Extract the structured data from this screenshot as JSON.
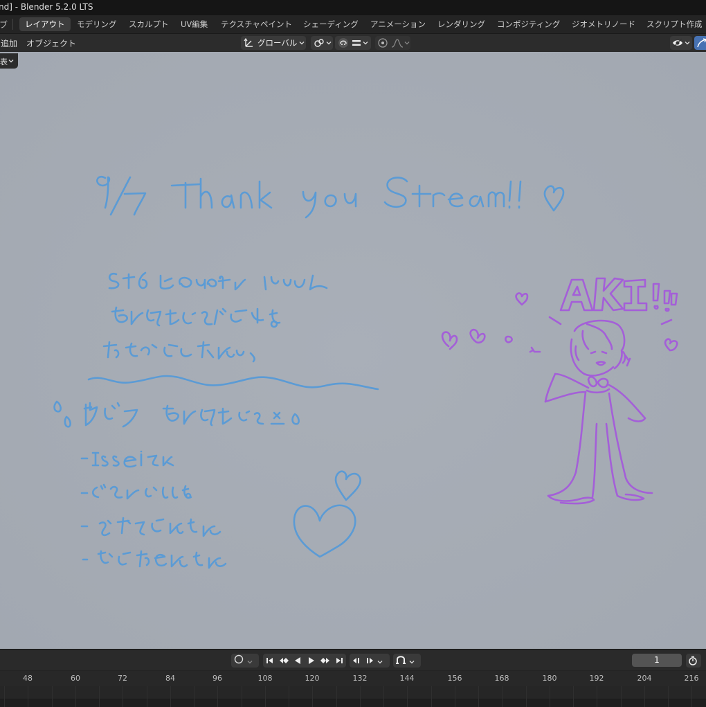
{
  "window": {
    "title": "nd] - Blender 5.2.0 LTS"
  },
  "menubar": {
    "fragment": "ブ",
    "workspaces": [
      "レイアウト",
      "モデリング",
      "スカルプト",
      "UV編集",
      "テクスチャペイント",
      "シェーディング",
      "アニメーション",
      "レンダリング",
      "コンポジティング",
      "ジオメトリノード",
      "スクリプト作成"
    ],
    "active_workspace": "レイアウト"
  },
  "header": {
    "menus": [
      "追加",
      "オブジェクト"
    ],
    "transform_orientation": "グローバル",
    "chip": "表"
  },
  "colors": {
    "viewport_bg": "#a6acb5",
    "blue_stroke": "#5b9bd5",
    "purple_stroke": "#a45fd8",
    "active_tab": "#3d3d3d",
    "accent": "#4772b3"
  },
  "icons": [
    "transform-orientation-icon",
    "snap-icon",
    "proportional-edit-icon",
    "visibility-icon",
    "gizmo-icon",
    "jump-start-icon",
    "prev-keyframe-icon",
    "play-reverse-icon",
    "play-icon",
    "next-keyframe-icon",
    "jump-end-icon",
    "stopwatch-icon"
  ],
  "timeline": {
    "current_frame": "1",
    "ruler_labels": [
      "48",
      "60",
      "72",
      "84",
      "96",
      "108",
      "120",
      "132",
      "144",
      "156",
      "168",
      "180",
      "192",
      "204",
      "216"
    ]
  }
}
